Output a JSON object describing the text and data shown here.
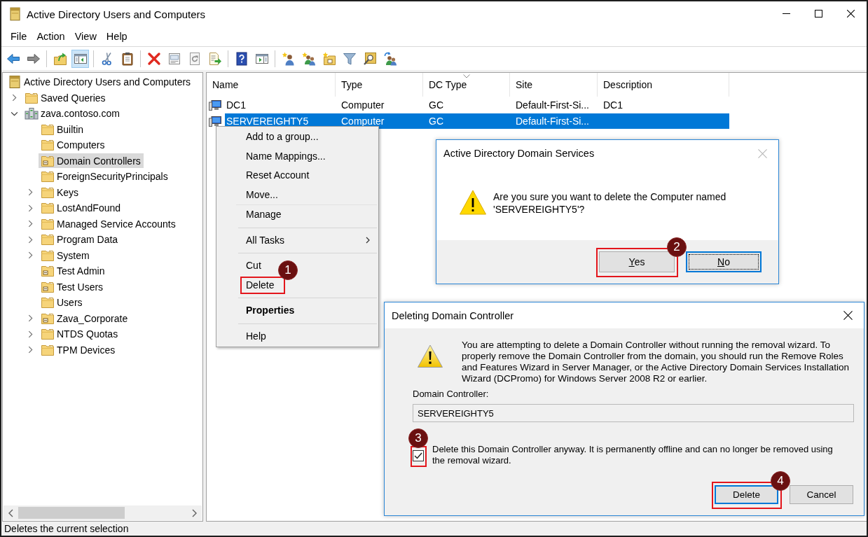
{
  "window": {
    "title": "Active Directory Users and Computers"
  },
  "menu_bar": [
    "File",
    "Action",
    "View",
    "Help"
  ],
  "toolbar": {
    "buttons": [
      {
        "pressed": false
      },
      {
        "pressed": false
      },
      {
        "pressed": false
      },
      {
        "pressed": true
      },
      {
        "pressed": false
      },
      {
        "pressed": false
      },
      {
        "pressed": false
      },
      {
        "pressed": false
      },
      {
        "pressed": false
      },
      {
        "pressed": false
      },
      {
        "pressed": false
      },
      {
        "pressed": false
      },
      {
        "pressed": false
      },
      {
        "pressed": false
      },
      {
        "pressed": false
      },
      {
        "pressed": false
      },
      {
        "pressed": false
      },
      {
        "pressed": false
      }
    ]
  },
  "tree": {
    "items": [
      {
        "label": "Active Directory Users and Computers",
        "kind": "snapin",
        "expandable": false,
        "selected": false,
        "children": [
          {
            "label": "Saved Queries",
            "kind": "folder",
            "expandable": true,
            "expanded": false,
            "selected": false
          },
          {
            "label": "zava.contoso.com",
            "kind": "domain",
            "expandable": true,
            "expanded": true,
            "selected": false,
            "children": [
              {
                "label": "Builtin",
                "kind": "folder",
                "expandable": false,
                "selected": false
              },
              {
                "label": "Computers",
                "kind": "folder",
                "expandable": false,
                "selected": false
              },
              {
                "label": "Domain Controllers",
                "kind": "ou",
                "expandable": false,
                "selected": true
              },
              {
                "label": "ForeignSecurityPrincipals",
                "kind": "folder",
                "expandable": false,
                "selected": false
              },
              {
                "label": "Keys",
                "kind": "folder",
                "expandable": true,
                "expanded": false,
                "selected": false
              },
              {
                "label": "LostAndFound",
                "kind": "folder",
                "expandable": true,
                "expanded": false,
                "selected": false
              },
              {
                "label": "Managed Service Accounts",
                "kind": "folder",
                "expandable": true,
                "expanded": false,
                "selected": false
              },
              {
                "label": "Program Data",
                "kind": "folder",
                "expandable": true,
                "expanded": false,
                "selected": false
              },
              {
                "label": "System",
                "kind": "folder",
                "expandable": true,
                "expanded": false,
                "selected": false
              },
              {
                "label": "Test Admin",
                "kind": "ou",
                "expandable": false,
                "selected": false
              },
              {
                "label": "Test Users",
                "kind": "ou",
                "expandable": false,
                "selected": false
              },
              {
                "label": "Users",
                "kind": "folder",
                "expandable": false,
                "selected": false
              },
              {
                "label": "Zava_Corporate",
                "kind": "ou",
                "expandable": true,
                "expanded": false,
                "selected": false
              },
              {
                "label": "NTDS Quotas",
                "kind": "folder",
                "expandable": true,
                "expanded": false,
                "selected": false
              },
              {
                "label": "TPM Devices",
                "kind": "folder",
                "expandable": true,
                "expanded": false,
                "selected": false
              }
            ]
          }
        ]
      }
    ]
  },
  "list": {
    "columns": [
      {
        "label": "Name",
        "sorted": false
      },
      {
        "label": "Type",
        "sorted": false
      },
      {
        "label": "DC Type",
        "sorted": true
      },
      {
        "label": "Site",
        "sorted": false
      },
      {
        "label": "Description",
        "sorted": false
      }
    ],
    "rows": [
      {
        "cells": [
          "DC1",
          "Computer",
          "GC",
          "Default-First-Si...",
          "DC1"
        ],
        "selected": false
      },
      {
        "cells": [
          "SERVEREIGHTY5",
          "Computer",
          "GC",
          "Default-First-Si..."
        ],
        "selected": true
      }
    ]
  },
  "context_menu": {
    "items": [
      {
        "kind": "item",
        "label": "Add to a group...",
        "bold": false,
        "submenu": false
      },
      {
        "kind": "item",
        "label": "Name Mappings...",
        "bold": false,
        "submenu": false
      },
      {
        "kind": "item",
        "label": "Reset Account",
        "bold": false,
        "submenu": false
      },
      {
        "kind": "item",
        "label": "Move...",
        "bold": false,
        "submenu": false
      },
      {
        "kind": "divider"
      },
      {
        "kind": "item",
        "label": "Manage",
        "bold": false,
        "submenu": false
      },
      {
        "kind": "separator"
      },
      {
        "kind": "item",
        "label": "All Tasks",
        "bold": false,
        "submenu": true
      },
      {
        "kind": "separator"
      },
      {
        "kind": "item",
        "label": "Cut",
        "bold": false,
        "submenu": false
      },
      {
        "kind": "item",
        "label": "Delete",
        "bold": false,
        "submenu": false,
        "step": "1"
      },
      {
        "kind": "separator"
      },
      {
        "kind": "item",
        "label": "Properties",
        "bold": true,
        "submenu": false
      },
      {
        "kind": "separator"
      },
      {
        "kind": "item",
        "label": "Help",
        "bold": false,
        "submenu": false
      }
    ]
  },
  "confirm_dialog": {
    "title": "Active Directory Domain Services",
    "close_disabled": true,
    "message": "Are you sure you want to delete the Computer named 'SERVEREIGHTY5'?",
    "buttons": [
      {
        "label": "Yes",
        "underline_first": true,
        "default": false,
        "focused": false,
        "step": "2"
      },
      {
        "label": "No",
        "underline_first": true,
        "default": true,
        "focused": true
      }
    ]
  },
  "delete_dialog": {
    "title": "Deleting Domain Controller",
    "close_disabled": false,
    "message": "You are attempting to delete a Domain Controller without running the removal wizard. To properly remove the Domain Controller from the domain, you should run the Remove Roles and Features Wizard in Server Manager, or the Active Directory Domain Services Installation Wizard (DCPromo) for Windows Server 2008 R2 or earlier.",
    "field": {
      "label": "Domain Controller:",
      "value": "SERVEREIGHTY5"
    },
    "checkbox": {
      "label": "Delete this Domain Controller anyway. It is permanently offline and can no longer be removed using the removal wizard.",
      "checked": true,
      "step": "3"
    },
    "buttons": [
      {
        "label": "Delete",
        "underline_first": false,
        "default": true,
        "focused": false,
        "step": "4"
      },
      {
        "label": "Cancel",
        "underline_first": false,
        "default": false,
        "focused": false
      }
    ]
  },
  "status_bar": {
    "text": "Deletes the current selection"
  }
}
